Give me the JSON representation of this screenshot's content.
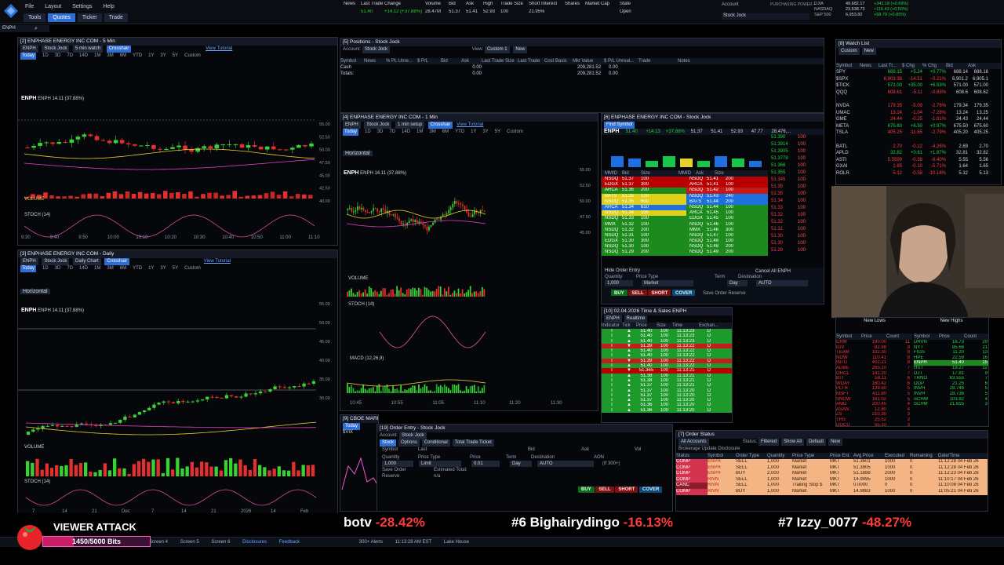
{
  "menu": {
    "file": "File",
    "layout": "Layout",
    "settings": "Settings",
    "help": "Help"
  },
  "tabs": [
    {
      "label": "Tools"
    },
    {
      "label": "Quotes"
    },
    {
      "label": "Ticker"
    },
    {
      "label": "Trade"
    }
  ],
  "account_area": {
    "account_label": "Account",
    "account_value": "Stock Jock",
    "buying_power_label": "PURCHASING POWER +"
  },
  "indices": [
    {
      "name": "DJIA",
      "value": "49,682.17",
      "change": "+341.18 (+0.69%)"
    },
    {
      "name": "NASDAQ",
      "value": "23,538.73",
      "change": "+116.43 (+0.50%)"
    },
    {
      "name": "S&P 500",
      "value": "6,953.82",
      "change": "+58.79 (+0.85%)"
    }
  ],
  "symbol_search": "ENPH",
  "quote_strip": {
    "headers": [
      "News",
      "Last Trade",
      "Change",
      "Volume",
      "Bid",
      "Ask",
      "High",
      "Trade Size",
      "Short Interest",
      "Shares",
      "Market Cap",
      "State"
    ],
    "values": [
      "",
      "51.40",
      "+14.12 (+37.88%)",
      "28.47M",
      "51.37",
      "51.41",
      "52.93",
      "100",
      "21.95%",
      "",
      "",
      "Open"
    ]
  },
  "chart_5min": {
    "title": "[2] ENPHASE ENERGY INC COM - 5 Min",
    "symbol": "ENPH",
    "account": "Stock Jock",
    "interval": "5 min watch",
    "mode": "Crosshair",
    "view_tutorial": "View Tutorial",
    "timeframes": [
      "Today",
      "1D",
      "3D",
      "7D",
      "14D",
      "1M",
      "3M",
      "6M",
      "YTD",
      "1Y",
      "3Y",
      "5Y",
      "Custom"
    ],
    "legend": "ENPH 14.11 (37.88%)",
    "study_volume": "VOLUME",
    "study_stoch": "STOCH (14)",
    "x_ticks": [
      "9:30",
      "9:40",
      "9:50",
      "10:00",
      "10:10",
      "10:20",
      "10:30",
      "10:40",
      "10:50",
      "11:00",
      "11:10"
    ],
    "y_ticks": [
      "55.00",
      "52.50",
      "50.00",
      "47.50",
      "45.00",
      "42.50",
      "40.00"
    ]
  },
  "chart_daily": {
    "title": "[3] ENPHASE ENERGY INC COM - Daily",
    "symbol": "ENPH",
    "account": "Stock Jock",
    "interval": "Daily Chart",
    "mode": "Crosshair",
    "view_tutorial": "View Tutorial",
    "timeframes": [
      "Today",
      "1D",
      "3D",
      "7D",
      "14D",
      "1M",
      "3M",
      "6M",
      "YTD",
      "1Y",
      "3Y",
      "5Y",
      "Custom"
    ],
    "drawing": "Horizontal",
    "legend": "ENPH 14.11 (37.88%)",
    "study_volume": "VOLUME",
    "study_stoch": "STOCH (14)",
    "x_ticks": [
      "7",
      "14",
      "21",
      "Dec",
      "7",
      "14",
      "21",
      "2026",
      "14",
      "Feb"
    ],
    "y_ticks": [
      "55.00",
      "50.00",
      "45.00",
      "40.00",
      "35.00",
      "30.00"
    ]
  },
  "positions": {
    "title": "[5] Positions - Stock Jock",
    "account": "Stock Jock",
    "view": "Custom 1",
    "new": "New",
    "headers": [
      "Symbol",
      "News",
      "% PL Unre...",
      "$ P/L",
      "Bid",
      "Ask",
      "Last Trade Size",
      "Last Trade",
      "Cost Basis",
      "Mkt Value",
      "$ P/L Unreal...",
      "Trade",
      "Notes"
    ],
    "rows": [
      {
        "symbol": "Cash",
        "mkt_value": "209,281.52",
        "pl": "0.00"
      },
      {
        "symbol": "Totals:",
        "mkt_value": "209,281.52",
        "pl": "0.00"
      }
    ]
  },
  "chart_1min": {
    "title": "[4] ENPHASE ENERGY INC COM - 1 Min",
    "symbol": "ENPH",
    "account": "Stock Jock",
    "interval": "1 min setup",
    "mode": "Crosshair",
    "view_tutorial": "View Tutorial",
    "timeframes": [
      "Today",
      "1D",
      "3D",
      "7D",
      "14D",
      "1M",
      "3M",
      "6M",
      "YTD",
      "1Y",
      "3Y",
      "5Y",
      "Custom"
    ],
    "drawing": "Horizontal",
    "legend": "ENPH 14.11 (37.88%)",
    "study_volume": "VOLUME",
    "study_stoch": "STOCH (14)",
    "study_macd": "MACD (12,26,9)",
    "x_ticks": [
      "10:45",
      "10:55",
      "11:05",
      "11:10",
      "11:20",
      "11:30"
    ],
    "y_ticks": [
      "55.00",
      "52.50",
      "50.00",
      "47.50",
      "45.00"
    ]
  },
  "level2": {
    "title": "[6] ENPHASE ENERGY INC COM - Stock Jock",
    "find_symbol": "Find Symbol",
    "symbol": "ENPH",
    "last": "51.40",
    "change": "+14.13",
    "pct": "+37.88%",
    "bid": "51.37",
    "ask": "51.41",
    "high": "52.93",
    "low": "47.77",
    "vol": "28,476,...",
    "headers": [
      "MMID",
      "Bid",
      "Size",
      "MMID",
      "Ask",
      "Size"
    ],
    "rows": [
      [
        "NSDQ",
        "51.37",
        "100",
        "NSDQ",
        "51.41",
        "200"
      ],
      [
        "EDGX",
        "51.37",
        "300",
        "ARCA",
        "51.41",
        "100"
      ],
      [
        "ARCA",
        "51.36",
        "200",
        "NSDQ",
        "51.42",
        "100"
      ],
      [
        "BATS",
        "51.35",
        "120",
        "NSDQ",
        "51.43",
        "240"
      ],
      [
        "NSDQ",
        "51.35",
        "600",
        "BATS",
        "51.44",
        "200"
      ],
      [
        "ARCA",
        "51.34",
        "610",
        "NSDQ",
        "51.44",
        "100"
      ],
      [
        "NSDQ",
        "51.34",
        "100",
        "ARCA",
        "51.45",
        "100"
      ],
      [
        "NSDQ",
        "51.33",
        "100",
        "EDGX",
        "51.45",
        "100"
      ],
      [
        "MMX",
        "51.32",
        "100",
        "NSDQ",
        "51.46",
        "100"
      ],
      [
        "NSDQ",
        "51.32",
        "200",
        "MMX",
        "51.46",
        "300"
      ],
      [
        "NSDQ",
        "51.31",
        "100",
        "NSDQ",
        "51.47",
        "100"
      ],
      [
        "EDGX",
        "51.30",
        "300",
        "NSDQ",
        "51.48",
        "100"
      ],
      [
        "NSDQ",
        "51.30",
        "100",
        "NSDQ",
        "51.48",
        "200"
      ],
      [
        "NSDQ",
        "51.29",
        "200",
        "NSDQ",
        "51.49",
        "200"
      ]
    ],
    "prints": [
      "51.390",
      "51.3914",
      "51.3905",
      "51.3778",
      "51.366",
      "51.355",
      "51.345",
      "51.35",
      "51.35",
      "51.34",
      "51.33",
      "51.32",
      "51.32",
      "51.31",
      "51.30",
      "51.30",
      "51.29"
    ],
    "hide_order_entry": "Hide Order Entry",
    "quantity_label": "Quantity",
    "quantity": "1,000",
    "price_type_label": "Price Type",
    "price_type": "Market",
    "term_label": "Term",
    "term": "Day",
    "destination_label": "Destination",
    "destination": "AUTO",
    "cancel_all": "Cancel All ENPH",
    "buy": "BUY",
    "sell": "SELL",
    "short": "SHORT",
    "cover": "COVER",
    "save_order": "Save Order",
    "reserve": "Reserve"
  },
  "time_sales": {
    "title": "[10] 02.04.2026 Time & Sales ENPH",
    "mode": "Realtime",
    "headers": [
      "Indicator",
      "Tick",
      "Price",
      "Size",
      "Time",
      "Exchan..."
    ],
    "rows": [
      [
        "T",
        "▲",
        "51.40",
        "100",
        "11:13:23",
        "D"
      ],
      [
        "T",
        "▲",
        "51.40",
        "100",
        "11:13:23",
        "D"
      ],
      [
        "T",
        "▲",
        "51.40",
        "100",
        "11:13:23",
        "D"
      ],
      [
        "T",
        "▼",
        "51.39",
        "100",
        "11:13:22",
        "D"
      ],
      [
        "T",
        "▲",
        "51.40",
        "100",
        "11:13:22",
        "D"
      ],
      [
        "T",
        "▲",
        "51.40",
        "100",
        "11:13:22",
        "D"
      ],
      [
        "T",
        "▼",
        "51.39",
        "100",
        "11:13:22",
        "D"
      ],
      [
        "T",
        "▲",
        "51.40",
        "100",
        "11:13:22",
        "D"
      ],
      [
        "T",
        "▼",
        "51.365",
        "100",
        "11:13:21",
        "D"
      ],
      [
        "T",
        "▲",
        "51.38",
        "100",
        "11:13:21",
        "D"
      ],
      [
        "T",
        "▲",
        "51.38",
        "100",
        "11:13:21",
        "D"
      ],
      [
        "T",
        "▲",
        "51.37",
        "100",
        "11:13:21",
        "D"
      ],
      [
        "T",
        "▲",
        "51.37",
        "100",
        "11:13:20",
        "D"
      ],
      [
        "T",
        "▲",
        "51.37",
        "100",
        "11:13:20",
        "D"
      ],
      [
        "T",
        "▲",
        "51.37",
        "100",
        "11:13:20",
        "D"
      ],
      [
        "T",
        "▲",
        "51.36",
        "100",
        "11:13:20",
        "D"
      ],
      [
        "T",
        "▲",
        "51.36",
        "100",
        "11:13:20",
        "D"
      ]
    ]
  },
  "cboe": {
    "title": "[9] CBOE MARKET VOLATILITY INDEX - 5",
    "symbol": "$VIX",
    "today": "Today"
  },
  "order_entry": {
    "title": "[19] Order Entry - Stock Jock",
    "account_label": "Account:",
    "account": "Stock Jock",
    "tabs": [
      "Stock",
      "Options",
      "Conditional",
      "Total Trade Ticket"
    ],
    "symbol_label": "Symbol",
    "last_label": "Last",
    "bid_label": "Bid",
    "ask_label": "Ask",
    "vol_label": "Vol",
    "quantity_label": "Quantity",
    "quantity": "1,000",
    "price_type_label": "Price Type",
    "price_type": "Limit",
    "price_label": "Price",
    "price": "0.01",
    "term_label": "Term",
    "term": "Day",
    "destination_label": "Destination",
    "destination": "AUTO",
    "aon": "AON",
    "min": "(If 300+)",
    "save_order": "Save Order",
    "reserve": "Reserve",
    "estimated_total": "Estimated Total:",
    "est_value": "n/a",
    "buy": "BUY",
    "sell": "SELL",
    "short": "SHORT",
    "cover": "COVER"
  },
  "watch_list": {
    "title": "[8] Watch List",
    "view": "Custom",
    "new": "New",
    "headers": [
      "Symbol",
      "News",
      "Last Tr...",
      "$ Chg",
      "% Chg",
      "Bid",
      "Ask"
    ],
    "rows": [
      [
        "SPY",
        "",
        "688.15",
        "+5.24",
        "+0.77%",
        "688.14",
        "688.16",
        "up"
      ],
      [
        "$SPX",
        "",
        "6,903.38",
        "-14.51",
        "-0.21%",
        "6,901.2",
        "6,905.1",
        "dn"
      ],
      [
        "$TICK",
        "",
        "571.00",
        "+35.00",
        "+6.53%",
        "571.00",
        "571.00",
        "up"
      ],
      [
        "QQQ",
        "",
        "608.61",
        "-5.11",
        "-0.83%",
        "608.6",
        "608.62",
        "dn"
      ],
      [
        "",
        "",
        "",
        "",
        "",
        "",
        "",
        ""
      ],
      [
        "NVDA",
        "",
        "179.35",
        "-5.09",
        "-2.76%",
        "179.34",
        "179.35",
        "dn"
      ],
      [
        "UMAC",
        "",
        "13.24",
        "-1.04",
        "-7.28%",
        "13.24",
        "13.25",
        "dn"
      ],
      [
        "GME",
        "",
        "24.44",
        "-0.25",
        "-1.01%",
        "24.43",
        "24.44",
        "dn"
      ],
      [
        "META",
        "",
        "675.60",
        "+6.50",
        "+0.97%",
        "675.50",
        "675.60",
        "up"
      ],
      [
        "TSLA",
        "",
        "405.25",
        "-11.65",
        "-2.79%",
        "405.20",
        "405.25",
        "dn"
      ],
      [
        "",
        "",
        "",
        "",
        "",
        "",
        "",
        ""
      ],
      [
        "BATL",
        "",
        "2.70",
        "-0.12",
        "-4.26%",
        "2.69",
        "2.70",
        "dn"
      ],
      [
        "APLD",
        "",
        "32.82",
        "+0.61",
        "+1.87%",
        "32.81",
        "32.82",
        "up"
      ],
      [
        "ASTI",
        "",
        "5.5599",
        "-0.38",
        "-6.40%",
        "5.55",
        "5.56",
        "dn"
      ],
      [
        "GXAI",
        "",
        "1.65",
        "-0.10",
        "-5.71%",
        "1.64",
        "1.65",
        "dn"
      ],
      [
        "ROLR",
        "",
        "5.12",
        "-0.58",
        "-10.18%",
        "5.12",
        "5.13",
        "dn"
      ]
    ]
  },
  "lows_highs": {
    "new_lows": "New Lows",
    "new_highs": "New Highs",
    "headers": [
      "Symbol",
      "Price",
      "Count"
    ],
    "lows": [
      [
        "CRM",
        "190.00",
        "11"
      ],
      [
        "IGV",
        "82.88",
        "9"
      ],
      [
        "TEAM",
        "102.30",
        "8"
      ],
      [
        "NOW",
        "110.41",
        "8"
      ],
      [
        "INTU",
        "402.21",
        "8"
      ],
      [
        "ADBE",
        "265.10",
        "7"
      ],
      [
        "ORCL",
        "141.20",
        "7"
      ],
      [
        "BTI",
        "58.11",
        "6"
      ],
      [
        "WDAY",
        "160.42",
        "6"
      ],
      [
        "PLTR",
        "139.50",
        "5"
      ],
      [
        "MSFT",
        "411.80",
        "5"
      ],
      [
        "SNOW",
        "161.02",
        "5"
      ],
      [
        "AMD",
        "200.45",
        "4"
      ],
      [
        "ASAN",
        "12.80",
        "4"
      ],
      [
        "ZS",
        "210.30",
        "3"
      ],
      [
        "THS",
        "25.52",
        "3"
      ],
      [
        "DOCU",
        "55.10",
        "3"
      ],
      [
        "TWLO",
        "111.60",
        "2"
      ]
    ],
    "highs": [
      [
        "DRVN",
        "16.73",
        "29"
      ],
      [
        "NYT",
        "85.66",
        "21"
      ],
      [
        "FIGS",
        "11.20",
        "13"
      ],
      [
        "HPE",
        "22.59",
        "16"
      ],
      [
        "ENPH",
        "51.40",
        "15"
      ],
      [
        "HST",
        "19.27",
        "12"
      ],
      [
        "DJT",
        "17.81",
        "9"
      ],
      [
        "TRNO",
        "63.555",
        "7"
      ],
      [
        "ODP",
        "21.25",
        "6"
      ],
      [
        "INVH",
        "28.746",
        "5"
      ],
      [
        "INVH",
        "28.736",
        "5"
      ],
      [
        "SCHW",
        "103.82",
        "4"
      ],
      [
        "SCHM",
        "21.655",
        "3"
      ]
    ]
  },
  "order_status": {
    "title": "[7] Order Status",
    "accounts": "All Accounts",
    "status": "Filtered",
    "show": "Show All",
    "view": "Default",
    "new": "New",
    "disclosure": "Brokerage Update Disclosure",
    "headers": [
      "Status",
      "Symbol",
      "Order Type",
      "Quantity",
      "Price Type",
      "Price Ent.",
      "Avg Price",
      "Executed",
      "Remaining",
      "Date/Time"
    ],
    "rows": [
      [
        "COMP",
        "ENPH",
        "SELL",
        "1,000",
        "Market",
        "MKT",
        "51.3601",
        "1000",
        "0",
        "11:12:28 04 Feb 26"
      ],
      [
        "COMP",
        "ENPH",
        "SELL",
        "1,000",
        "Market",
        "MKT",
        "51.3905",
        "1000",
        "0",
        "11:12:28 04 Feb 26"
      ],
      [
        "COMP",
        "ENPH",
        "BUY",
        "2,000",
        "Market",
        "MKT",
        "51.1888",
        "2000",
        "0",
        "11:12:23 04 Feb 26"
      ],
      [
        "COMP",
        "RIVN",
        "SELL",
        "1,000",
        "Market",
        "MKT",
        "14.9495",
        "1000",
        "0",
        "11:10:17 04 Feb 26"
      ],
      [
        "CANC",
        "RIVN",
        "SELL",
        "1,000",
        "Trailing Stop $",
        "MKT",
        "0.0000",
        "0",
        "0",
        "11:10:08 04 Feb 26"
      ],
      [
        "COMP",
        "RIVN",
        "BUY",
        "1,000",
        "Market",
        "MKT",
        "14.9883",
        "1000",
        "0",
        "11:05:21 04 Feb 26"
      ]
    ]
  },
  "ticker_tape": [
    {
      "text": "botv  -28.42%"
    },
    {
      "text": "#6  Bighairydingo  -16.13%"
    },
    {
      "text": "#7  Izzy_0077  -48.27%"
    }
  ],
  "alert": {
    "title": "VIEWER ATTACK",
    "progress": "1450/5000 Bits",
    "progress_fraction": 0.29
  },
  "bottombar": {
    "screens": [
      "Screen 4",
      "Screen 5",
      "Screen 6"
    ],
    "disclosures": "Disclosures",
    "feedback": "Feedback",
    "alerts": "300+ Alerts",
    "time": "11:13:28 AM EST",
    "location": "Lake House"
  }
}
